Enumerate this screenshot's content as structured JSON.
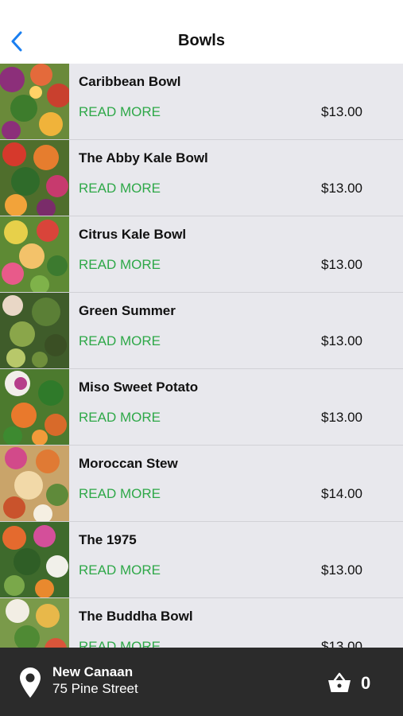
{
  "header": {
    "title": "Bowls",
    "back_icon": "chevron-left-icon",
    "accent_color": "#1a7ff0"
  },
  "list": {
    "read_more_label": "READ MORE",
    "link_color": "#2ea848",
    "items": [
      {
        "name": "Caribbean Bowl",
        "price": "$13.00"
      },
      {
        "name": "The Abby Kale Bowl",
        "price": "$13.00"
      },
      {
        "name": "Citrus Kale Bowl",
        "price": "$13.00"
      },
      {
        "name": "Green Summer",
        "price": "$13.00"
      },
      {
        "name": "Miso Sweet Potato",
        "price": "$13.00"
      },
      {
        "name": "Moroccan Stew",
        "price": "$14.00"
      },
      {
        "name": "The 1975",
        "price": "$13.00"
      },
      {
        "name": "The Buddha Bowl",
        "price": "$13.00"
      }
    ]
  },
  "footer": {
    "location_icon": "map-pin-icon",
    "location_name": "New Canaan",
    "location_address": "75 Pine Street",
    "cart_icon": "basket-icon",
    "cart_count": "0"
  }
}
